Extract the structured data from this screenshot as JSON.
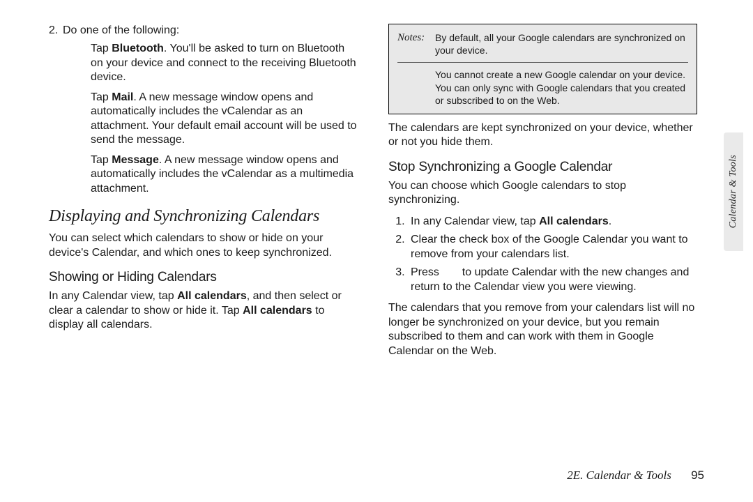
{
  "left": {
    "step2_intro": "Do one of the following:",
    "bt_lead": "Bluetooth",
    "bt_text_before": "Tap ",
    "bt_text_after": ". You'll be asked to turn on Bluetooth on your device and connect to the receiving Bluetooth device.",
    "mail_lead": "Mail",
    "mail_text_before": "Tap ",
    "mail_text_after": ". A new message window opens and automatically includes the vCalendar as an attachment. Your default email account will be used to send the message.",
    "msg_lead": "Message",
    "msg_text_before": "Tap ",
    "msg_text_after": ". A new message window opens and automatically includes the vCalendar as a multimedia attachment.",
    "section_title": "Displaying and Synchronizing Calendars",
    "section_body": "You can select which calendars to show or hide on your device's Calendar, and which ones to keep synchronized.",
    "sub_title": "Showing or Hiding Calendars",
    "sub_body_1": "In any Calendar view, tap ",
    "sub_body_bold1": "All calendars",
    "sub_body_2": ", and then select or clear a calendar to show or hide it. Tap ",
    "sub_body_bold2": "All calendars",
    "sub_body_3": " to display all calendars."
  },
  "right": {
    "notes_label": "Notes:",
    "note1": "By default, all your Google calendars are synchronized on your device.",
    "note2": "You cannot create a new Google calendar on your device. You can only sync with Google calendars that you created or subscribed to on the Web.",
    "after_notes": "The calendars are kept synchronized on your device, whether or not you hide them.",
    "sub_title": "Stop Synchronizing a Google Calendar",
    "sub_intro": "You can choose which Google calendars to stop synchronizing.",
    "step1_a": "In any Calendar view, tap ",
    "step1_bold": "All calendars",
    "step1_b": ".",
    "step2": "Clear the check box of the Google Calendar you want to remove from your calendars list.",
    "step3_a": "Press ",
    "step3_b": " to update Calendar with the new changes and return to the Calendar view you were viewing.",
    "closing": "The calendars that you remove from your calendars list will no longer be synchronized on your device, but you remain subscribed to them and can work with them in Google Calendar on the Web."
  },
  "side_tab": "Calendar & Tools",
  "footer": {
    "section": "2E. Calendar & Tools",
    "page": "95"
  }
}
